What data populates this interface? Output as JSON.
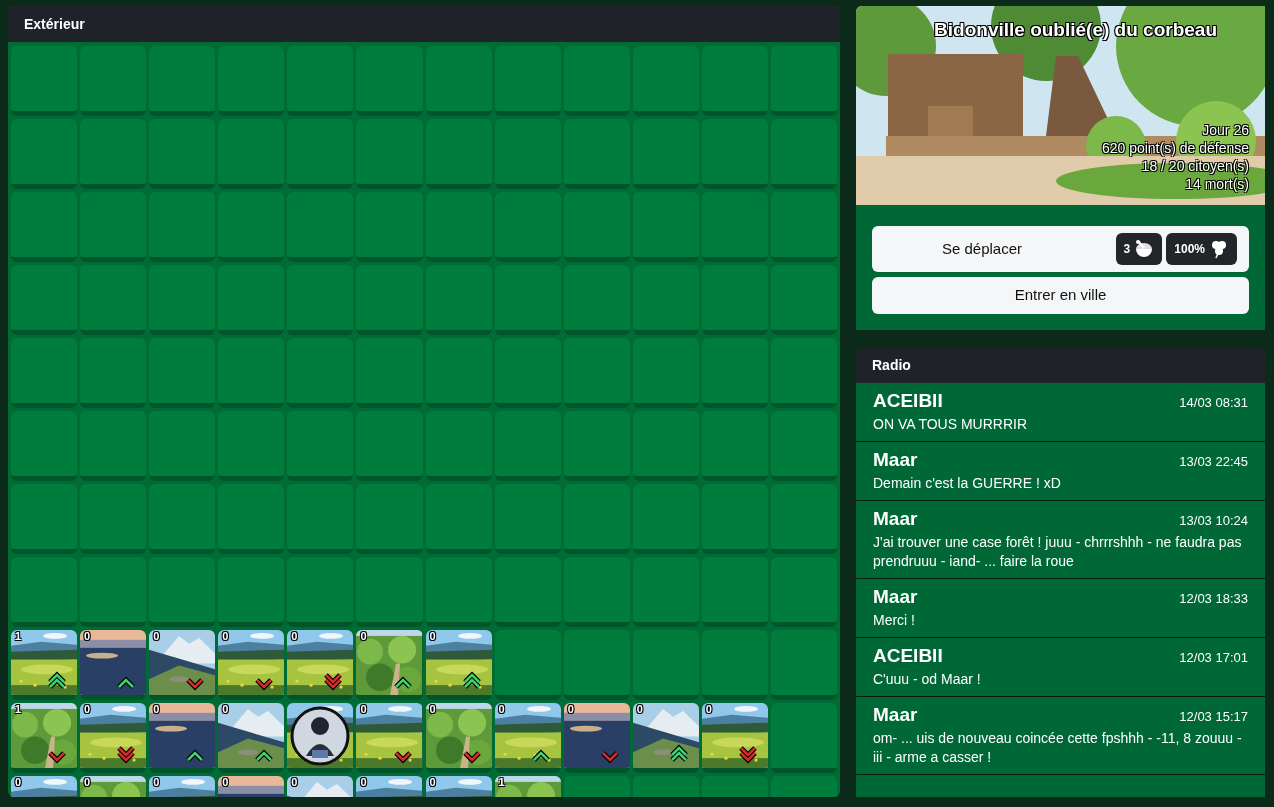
{
  "exterior": {
    "title": "Extérieur",
    "rows": [
      {
        "cells": [
          {
            "kind": "empty"
          },
          {
            "kind": "empty"
          },
          {
            "kind": "empty"
          },
          {
            "kind": "empty"
          },
          {
            "kind": "empty"
          },
          {
            "kind": "empty"
          },
          {
            "kind": "empty"
          },
          {
            "kind": "empty"
          },
          {
            "kind": "empty"
          },
          {
            "kind": "empty"
          },
          {
            "kind": "empty"
          },
          {
            "kind": "empty"
          }
        ]
      },
      {
        "cells": [
          {
            "kind": "empty"
          },
          {
            "kind": "empty"
          },
          {
            "kind": "empty"
          },
          {
            "kind": "empty"
          },
          {
            "kind": "empty"
          },
          {
            "kind": "empty"
          },
          {
            "kind": "empty"
          },
          {
            "kind": "empty"
          },
          {
            "kind": "empty"
          },
          {
            "kind": "empty"
          },
          {
            "kind": "empty"
          },
          {
            "kind": "empty"
          }
        ]
      },
      {
        "cells": [
          {
            "kind": "empty"
          },
          {
            "kind": "empty"
          },
          {
            "kind": "empty"
          },
          {
            "kind": "empty"
          },
          {
            "kind": "empty"
          },
          {
            "kind": "empty"
          },
          {
            "kind": "empty"
          },
          {
            "kind": "empty"
          },
          {
            "kind": "empty"
          },
          {
            "kind": "empty"
          },
          {
            "kind": "empty"
          },
          {
            "kind": "empty"
          }
        ]
      },
      {
        "cells": [
          {
            "kind": "empty"
          },
          {
            "kind": "empty"
          },
          {
            "kind": "empty"
          },
          {
            "kind": "empty"
          },
          {
            "kind": "empty"
          },
          {
            "kind": "empty"
          },
          {
            "kind": "empty"
          },
          {
            "kind": "empty"
          },
          {
            "kind": "empty"
          },
          {
            "kind": "empty"
          },
          {
            "kind": "empty"
          },
          {
            "kind": "empty"
          }
        ]
      },
      {
        "cells": [
          {
            "kind": "empty"
          },
          {
            "kind": "empty"
          },
          {
            "kind": "empty"
          },
          {
            "kind": "empty"
          },
          {
            "kind": "empty"
          },
          {
            "kind": "empty"
          },
          {
            "kind": "empty"
          },
          {
            "kind": "empty"
          },
          {
            "kind": "empty"
          },
          {
            "kind": "empty"
          },
          {
            "kind": "empty"
          },
          {
            "kind": "empty"
          }
        ]
      },
      {
        "cells": [
          {
            "kind": "empty"
          },
          {
            "kind": "empty"
          },
          {
            "kind": "empty"
          },
          {
            "kind": "empty"
          },
          {
            "kind": "empty"
          },
          {
            "kind": "empty"
          },
          {
            "kind": "empty"
          },
          {
            "kind": "empty"
          },
          {
            "kind": "empty"
          },
          {
            "kind": "empty"
          },
          {
            "kind": "empty"
          },
          {
            "kind": "empty"
          }
        ]
      },
      {
        "cells": [
          {
            "kind": "empty"
          },
          {
            "kind": "empty"
          },
          {
            "kind": "empty"
          },
          {
            "kind": "empty"
          },
          {
            "kind": "empty"
          },
          {
            "kind": "empty"
          },
          {
            "kind": "empty"
          },
          {
            "kind": "empty"
          },
          {
            "kind": "empty"
          },
          {
            "kind": "empty"
          },
          {
            "kind": "empty"
          },
          {
            "kind": "empty"
          }
        ]
      },
      {
        "cells": [
          {
            "kind": "empty"
          },
          {
            "kind": "empty"
          },
          {
            "kind": "empty"
          },
          {
            "kind": "empty"
          },
          {
            "kind": "empty"
          },
          {
            "kind": "empty"
          },
          {
            "kind": "empty"
          },
          {
            "kind": "empty"
          },
          {
            "kind": "empty"
          },
          {
            "kind": "empty"
          },
          {
            "kind": "empty"
          },
          {
            "kind": "empty"
          }
        ]
      },
      {
        "cells": [
          {
            "kind": "zone",
            "count": "1",
            "rising": true,
            "double": true,
            "player": false
          },
          {
            "kind": "zone",
            "count": "0",
            "rising": true,
            "double": false,
            "player": false
          },
          {
            "kind": "zone",
            "count": "0",
            "rising": false,
            "double": false,
            "player": false
          },
          {
            "kind": "zone",
            "count": "0",
            "rising": false,
            "double": false,
            "player": false
          },
          {
            "kind": "zone",
            "count": "0",
            "rising": false,
            "double": true,
            "player": false
          },
          {
            "kind": "zone",
            "count": "0",
            "rising": true,
            "double": false,
            "player": false
          },
          {
            "kind": "zone",
            "count": "0",
            "rising": true,
            "double": true,
            "player": false
          },
          {
            "kind": "empty"
          },
          {
            "kind": "empty"
          },
          {
            "kind": "empty"
          },
          {
            "kind": "empty"
          },
          {
            "kind": "empty"
          }
        ]
      },
      {
        "cells": [
          {
            "kind": "zone",
            "count": "1",
            "rising": false,
            "double": false,
            "player": false
          },
          {
            "kind": "zone",
            "count": "0",
            "rising": false,
            "double": true,
            "player": false
          },
          {
            "kind": "zone",
            "count": "0",
            "rising": true,
            "double": false,
            "player": false
          },
          {
            "kind": "zone",
            "count": "0",
            "rising": true,
            "double": false,
            "player": false
          },
          {
            "kind": "zone",
            "player": true
          },
          {
            "kind": "zone",
            "count": "0",
            "rising": false,
            "double": false,
            "player": false
          },
          {
            "kind": "zone",
            "count": "0",
            "rising": false,
            "double": false,
            "player": false
          },
          {
            "kind": "zone",
            "count": "0",
            "rising": true,
            "double": false,
            "player": false
          },
          {
            "kind": "zone",
            "count": "0",
            "rising": false,
            "double": false,
            "player": false
          },
          {
            "kind": "zone",
            "count": "0",
            "rising": true,
            "double": true,
            "player": false
          },
          {
            "kind": "zone",
            "count": "0",
            "rising": false,
            "double": true,
            "player": false
          },
          {
            "kind": "empty"
          }
        ]
      },
      {
        "cells": [
          {
            "kind": "zone",
            "count": "0",
            "player": false
          },
          {
            "kind": "zone",
            "count": "0",
            "player": false
          },
          {
            "kind": "zone",
            "count": "0",
            "player": false
          },
          {
            "kind": "zone",
            "count": "0",
            "player": false
          },
          {
            "kind": "zone",
            "count": "0",
            "player": false
          },
          {
            "kind": "zone",
            "count": "0",
            "player": false
          },
          {
            "kind": "zone",
            "count": "0",
            "player": false
          },
          {
            "kind": "zone",
            "count": "1",
            "player": false
          },
          {
            "kind": "empty"
          },
          {
            "kind": "empty"
          },
          {
            "kind": "empty"
          },
          {
            "kind": "empty"
          }
        ]
      }
    ]
  },
  "town": {
    "name": "Bidonville oublié(e) du corbeau",
    "stats": [
      "Jour 26",
      "620 point(s) de défense",
      "18 / 20 citoyen(s)",
      "14 mort(s)"
    ],
    "actions": [
      {
        "label": "Se déplacer",
        "badges": [
          {
            "kind": "ap",
            "text": "3"
          },
          {
            "kind": "luck",
            "text": "100%"
          }
        ]
      },
      {
        "label": "Entrer en ville"
      }
    ]
  },
  "radio": {
    "title": "Radio",
    "messages": [
      {
        "author": "ACEIBII",
        "time": "14/03 08:31",
        "text": "ON VA TOUS MURRRIR"
      },
      {
        "author": "Maar",
        "time": "13/03 22:45",
        "text": "Demain c'est la GUERRE ! xD"
      },
      {
        "author": "Maar",
        "time": "13/03 10:24",
        "text": "J'ai trouver une case forêt ! juuu - chrrrshhh - ne faudra pas prendruuu - iand- ... faire la roue"
      },
      {
        "author": "Maar",
        "time": "12/03 18:33",
        "text": "Merci !"
      },
      {
        "author": "ACEIBII",
        "time": "12/03 17:01",
        "text": "C'uuu - od Maar !"
      },
      {
        "author": "Maar",
        "time": "12/03 15:17",
        "text": "om- ... uis de nouveau coincée cette fpshhh - -11, 8 zouuu - iii - arme a casser !"
      }
    ]
  }
}
